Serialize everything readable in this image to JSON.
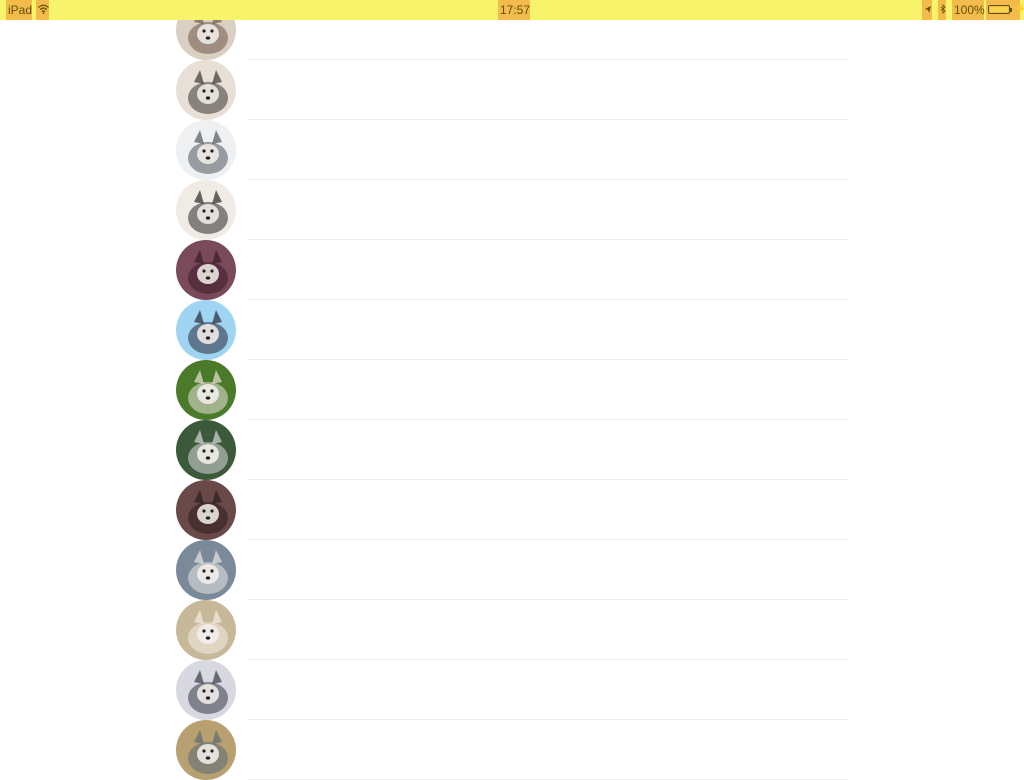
{
  "status_bar": {
    "carrier": "iPad",
    "time": "17:57",
    "battery_percent": "100%",
    "battery_level": 1.0,
    "background": "#f7f36a",
    "icons": [
      "wifi-icon",
      "location-arrow-icon",
      "bluetooth-icon",
      "battery-icon",
      "charging-bolt-icon"
    ]
  },
  "list": {
    "items": [
      {
        "avatar": "dog-avatar-1",
        "colors": [
          "#d9cfc2",
          "#6f5a4a"
        ]
      },
      {
        "avatar": "dog-avatar-2",
        "colors": [
          "#e8dfd7",
          "#3a3330"
        ]
      },
      {
        "avatar": "dog-avatar-3",
        "colors": [
          "#eef0f2",
          "#505860"
        ]
      },
      {
        "avatar": "dog-avatar-4",
        "colors": [
          "#f0ebe5",
          "#2a2a2a"
        ]
      },
      {
        "avatar": "dog-avatar-5",
        "colors": [
          "#7a4a5a",
          "#3a1a28"
        ]
      },
      {
        "avatar": "dog-avatar-6",
        "colors": [
          "#9fd4f2",
          "#2a2a38"
        ]
      },
      {
        "avatar": "dog-avatar-7",
        "colors": [
          "#4a7a2a",
          "#e8e2d8"
        ]
      },
      {
        "avatar": "dog-avatar-8",
        "colors": [
          "#3a5a3a",
          "#d8d8dc"
        ]
      },
      {
        "avatar": "dog-avatar-9",
        "colors": [
          "#6a4a48",
          "#2a1e1e"
        ]
      },
      {
        "avatar": "dog-avatar-10",
        "colors": [
          "#7a8a9a",
          "#e8e6e2"
        ]
      },
      {
        "avatar": "dog-avatar-11",
        "colors": [
          "#c8b89a",
          "#f2ece2"
        ]
      },
      {
        "avatar": "dog-avatar-12",
        "colors": [
          "#d8d8e0",
          "#3a3a48"
        ]
      },
      {
        "avatar": "dog-avatar-13",
        "colors": [
          "#b8a070",
          "#5a6a7a"
        ]
      }
    ]
  }
}
